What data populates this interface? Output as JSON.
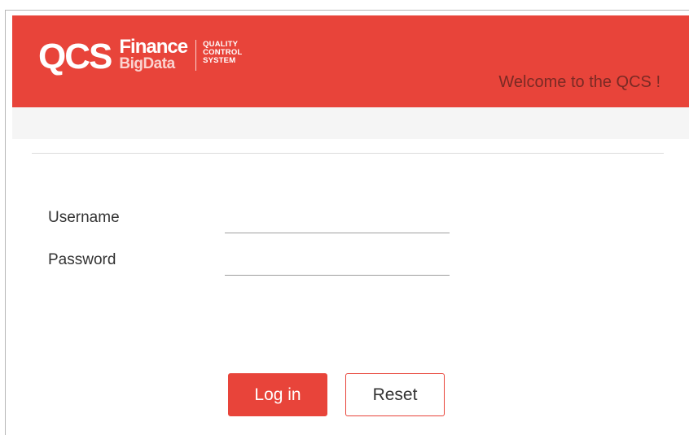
{
  "header": {
    "logo": {
      "qcs": "QCS",
      "finance": "Finance",
      "bigdata": "BigData",
      "line1": "QUALITY",
      "line2": "CONTROL",
      "line3": "SYSTEM"
    },
    "welcome": "Welcome to the QCS !"
  },
  "form": {
    "username_label": "Username",
    "username_value": "",
    "password_label": "Password",
    "password_value": "",
    "login_label": "Log in",
    "reset_label": "Reset"
  },
  "colors": {
    "brand": "#e8443a",
    "welcome_text": "#7a2a24",
    "subbar": "#f5f5f5"
  }
}
